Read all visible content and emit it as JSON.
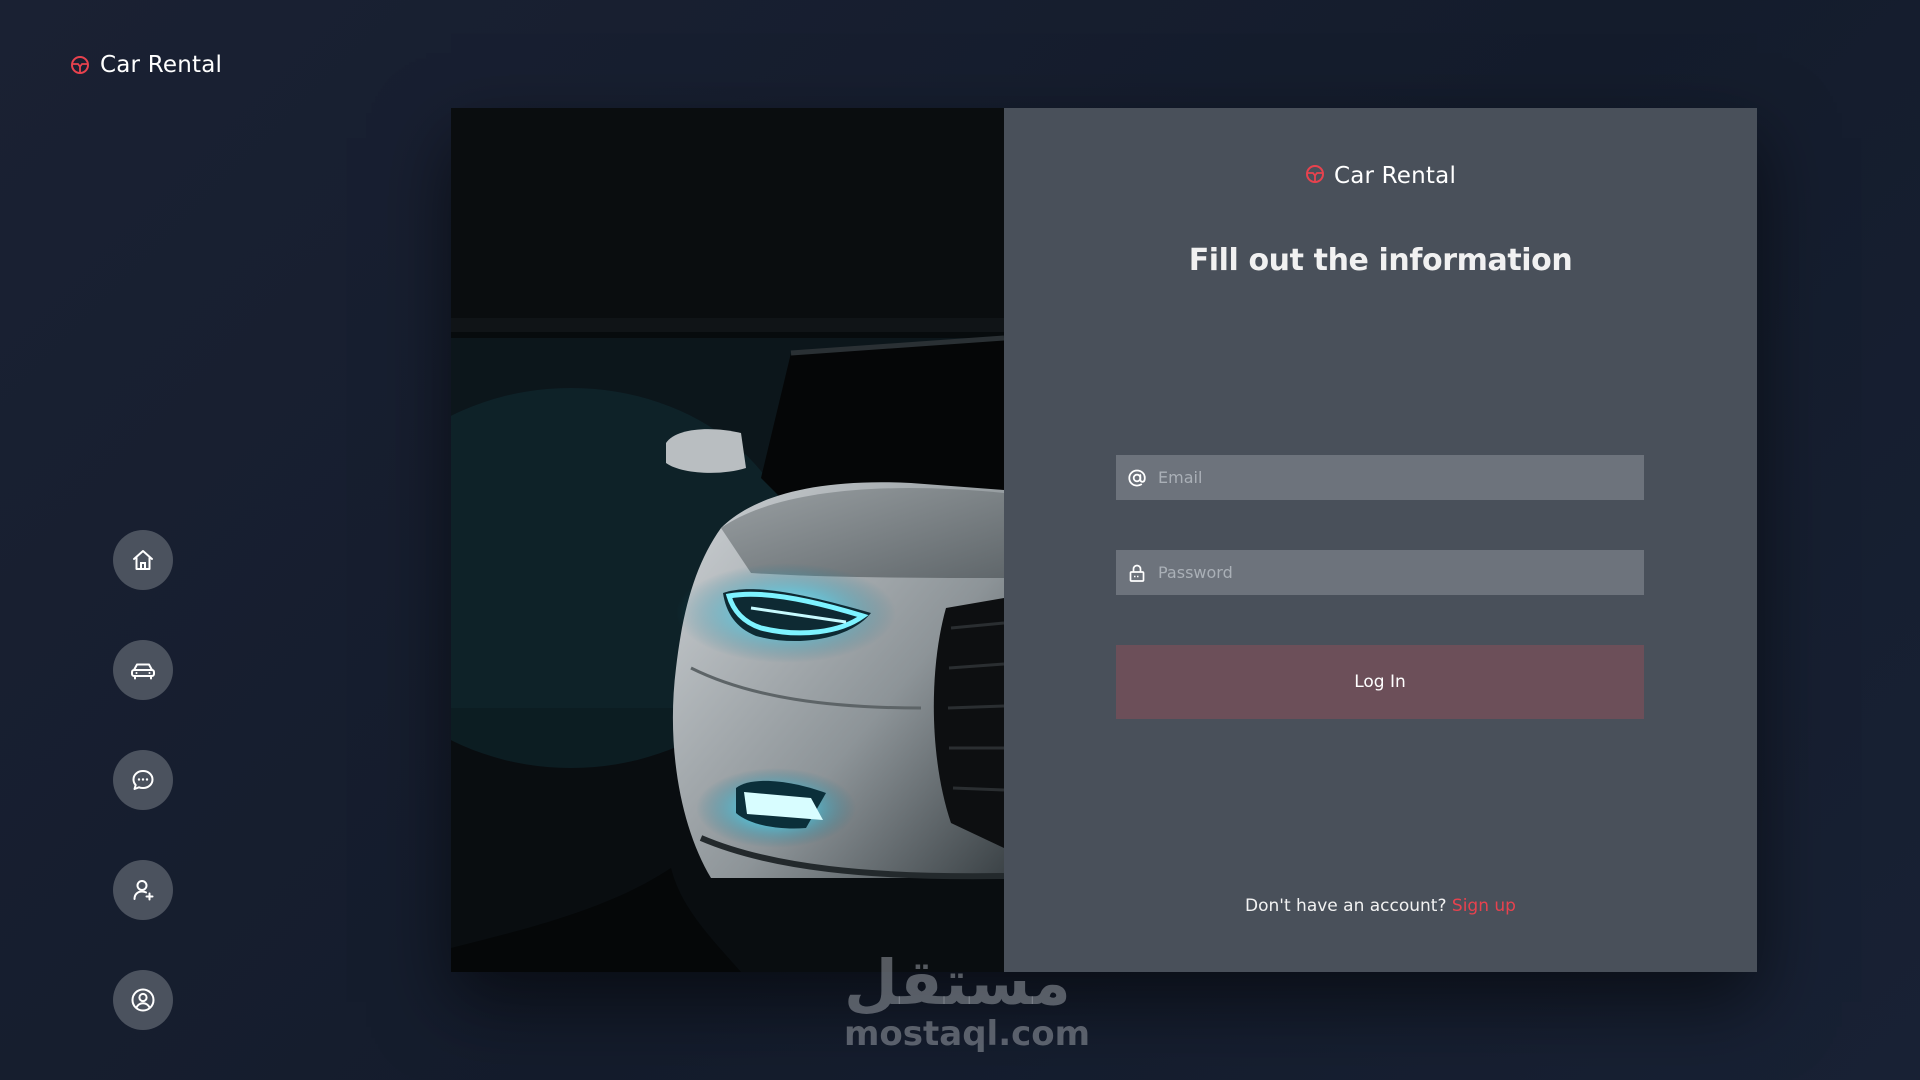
{
  "app": {
    "brand_name": "Car Rental",
    "brand_icon": "steering-wheel-icon",
    "accent_color": "#e8424e"
  },
  "sidebar": {
    "items": [
      {
        "icon": "home-icon",
        "label": "Home"
      },
      {
        "icon": "car-icon",
        "label": "Cars"
      },
      {
        "icon": "chat-icon",
        "label": "Messages"
      },
      {
        "icon": "add-user-icon",
        "label": "Add user"
      },
      {
        "icon": "profile-icon",
        "label": "Profile"
      }
    ]
  },
  "login": {
    "brand_name": "Car Rental",
    "heading": "Fill out the information",
    "email": {
      "placeholder": "Email",
      "value": "",
      "icon": "at-sign-icon"
    },
    "password": {
      "placeholder": "Password",
      "value": "",
      "icon": "lock-icon"
    },
    "submit_label": "Log In",
    "signup_prompt": "Don't have an account?",
    "signup_link": "Sign up"
  },
  "colors": {
    "page_background": "#161d2d",
    "panel_background": "#49505a",
    "field_background": "#6d737c",
    "button_background": "#6c4f59"
  },
  "watermark": {
    "arabic": "مستقل",
    "latin": "mostaql.com"
  }
}
